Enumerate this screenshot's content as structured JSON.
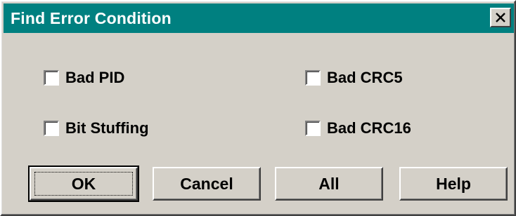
{
  "window": {
    "title": "Find Error Condition",
    "close_icon": "close-icon"
  },
  "options": [
    {
      "label": "Bad PID",
      "checked": false
    },
    {
      "label": "Bad CRC5",
      "checked": false
    },
    {
      "label": "Bit Stuffing",
      "checked": false
    },
    {
      "label": "Bad CRC16",
      "checked": false
    }
  ],
  "buttons": {
    "ok": "OK",
    "cancel": "Cancel",
    "all": "All",
    "help": "Help"
  },
  "colors": {
    "titlebar": "#008080",
    "face": "#d4d0c8",
    "title_text": "#ffffff"
  }
}
